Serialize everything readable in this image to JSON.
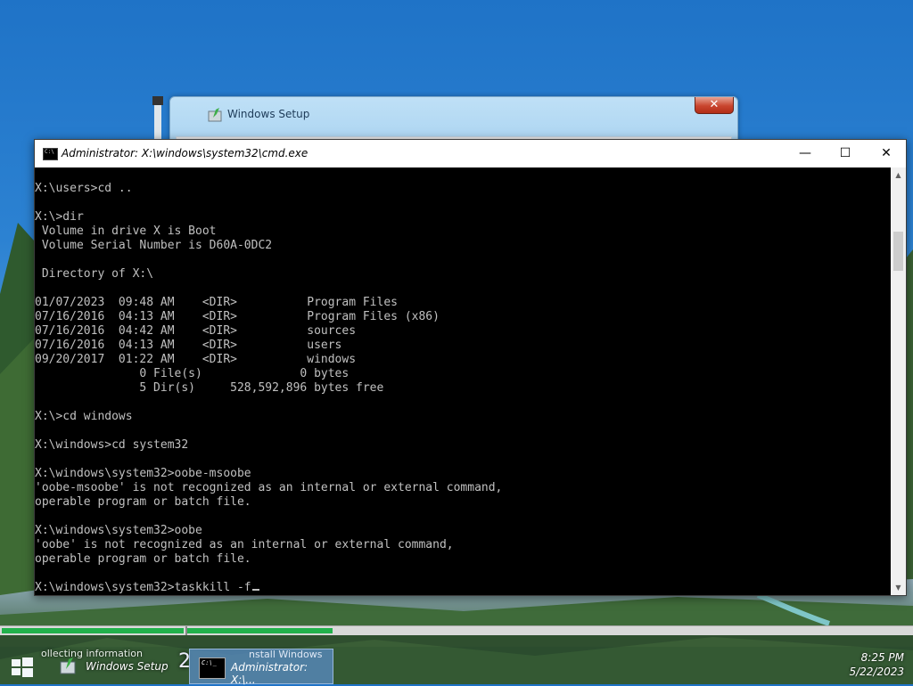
{
  "setup_window": {
    "title": "Windows Setup",
    "close_label": "✕"
  },
  "cmd_window": {
    "title": "Administrator: X:\\windows\\system32\\cmd.exe",
    "icon_text": "C:\\",
    "minimize": "—",
    "maximize": "☐",
    "close": "✕",
    "lines": [
      "X:\\users>cd ..",
      "",
      "X:\\>dir",
      " Volume in drive X is Boot",
      " Volume Serial Number is D60A-0DC2",
      "",
      " Directory of X:\\",
      "",
      "01/07/2023  09:48 AM    <DIR>          Program Files",
      "07/16/2016  04:13 AM    <DIR>          Program Files (x86)",
      "07/16/2016  04:42 AM    <DIR>          sources",
      "07/16/2016  04:13 AM    <DIR>          users",
      "09/20/2017  01:22 AM    <DIR>          windows",
      "               0 File(s)              0 bytes",
      "               5 Dir(s)     528,592,896 bytes free",
      "",
      "X:\\>cd windows",
      "",
      "X:\\windows>cd system32",
      "",
      "X:\\windows\\system32>oobe-msoobe",
      "'oobe-msoobe' is not recognized as an internal or external command,",
      "operable program or batch file.",
      "",
      "X:\\windows\\system32>oobe",
      "'oobe' is not recognized as an internal or external command,",
      "operable program or batch file.",
      ""
    ],
    "prompt_line": "X:\\windows\\system32>taskkill -f",
    "scroll_up": "▲",
    "scroll_down": "▼"
  },
  "progress": {
    "segment1_fraction": 0.2,
    "segment2_fraction": 0.16,
    "fill_color": "#22b14c"
  },
  "taskbar": {
    "setup_sub": "ollecting information",
    "setup_label": "Windows Setup",
    "number": "2",
    "cmd_sub": "nstall Windows",
    "cmd_label": "Administrator: X:\\...",
    "cmd_icon_text": "C:\\_"
  },
  "clock": {
    "time": "8:25 PM",
    "date": "5/22/2023"
  }
}
